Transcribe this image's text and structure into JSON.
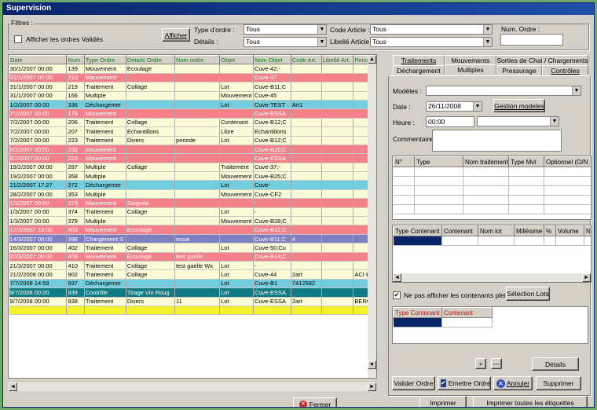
{
  "window": {
    "title": "Supervision"
  },
  "filters": {
    "group_label": "Filtres :",
    "show_validated_label": "Afficher les ordres Validés",
    "afficher_button": "Afficher",
    "type_ordre_label": "Type d'ordre :",
    "type_ordre_value": "Tous",
    "details_label": "Détails :",
    "details_value": "Tous",
    "code_article_label": "Code Article :",
    "code_article_value": "Tous",
    "libelle_article_label": "Libellé Article :",
    "libelle_article_value": "Tous",
    "num_ordre_label": "Num. Ordre :",
    "num_ordre_value": ""
  },
  "grid": {
    "columns": [
      "Date",
      "Num.",
      "Type Ordre",
      "Détails Ordre",
      "Nom ordre",
      "Objet",
      "Nom Objet",
      "Code Art.",
      "Libellé Art.",
      "Personn"
    ],
    "rows": [
      {
        "color": "lightyellow",
        "cells": [
          "30/1/2007 00:00",
          "139",
          "Mouvement",
          "Ecoulage",
          "",
          "",
          "Cuve-42;-",
          "",
          "",
          ""
        ]
      },
      {
        "color": "pink",
        "cells": [
          "31/1/2007 00:00",
          "210",
          "Mouvement",
          "",
          "",
          "",
          "Cuve-37",
          "",
          "",
          ""
        ]
      },
      {
        "color": "lightyellow",
        "cells": [
          "31/1/2007 00:00",
          "219",
          "Traitement",
          "Collage",
          "",
          "Lot",
          "Cuve-B11;C",
          "",
          "",
          ""
        ]
      },
      {
        "color": "lightyellow",
        "cells": [
          "31/1/2007 00:00",
          "166",
          "Multiple",
          "",
          "",
          "Mouvement",
          "Cuve-45",
          "",
          "",
          ""
        ]
      },
      {
        "color": "cyan",
        "cells": [
          "1/2/2007 00:00",
          "336",
          "Déchargemer",
          "",
          "",
          "Lot",
          "Cuve-TEST",
          "Art1",
          "",
          ""
        ]
      },
      {
        "color": "pink",
        "cells": [
          "7/2/2007 00:00",
          "179",
          "Mouvement",
          "",
          "",
          "",
          "Cuve-ESSA",
          "",
          "",
          ""
        ]
      },
      {
        "color": "lightyellow",
        "cells": [
          "7/2/2007 00:00",
          "206",
          "Traitement",
          "Collage",
          "",
          "Contenant",
          "Cuve-B12;C",
          "",
          "",
          ""
        ]
      },
      {
        "color": "lightyellow",
        "cells": [
          "7/2/2007 00:00",
          "207",
          "Traitement",
          "Echantillons",
          "",
          "Libre",
          "Echantillons",
          "",
          "",
          ""
        ]
      },
      {
        "color": "lightyellow",
        "cells": [
          "7/2/2007 00:00",
          "223",
          "Traitement",
          "Divers",
          "periode",
          "Lot",
          "Cuve-B12;C",
          "",
          "",
          ""
        ]
      },
      {
        "color": "pink",
        "cells": [
          "8/2/2007 00:00",
          "235",
          "Mouvement",
          "",
          "",
          "",
          "Cuve-B25;C",
          "",
          "",
          ""
        ]
      },
      {
        "color": "pink",
        "cells": [
          "8/2/2007 00:00",
          "226",
          "Mouvement",
          "",
          "",
          "",
          "Cuve-ESSA",
          "",
          "",
          ""
        ]
      },
      {
        "color": "lightyellow",
        "cells": [
          "19/2/2007 00:00",
          "287",
          "Multiple",
          "Collage",
          "",
          "Traitement",
          "Cuve-37;-",
          "",
          "",
          ""
        ]
      },
      {
        "color": "lightyellow",
        "cells": [
          "19/2/2007 00:00",
          "358",
          "Multiple",
          "",
          "",
          "Mouvement",
          "Cuve-B25;C",
          "",
          "",
          ""
        ]
      },
      {
        "color": "cyan",
        "cells": [
          "21/2/2007 17:27",
          "372",
          "Déchargemer",
          "",
          "",
          "Lot",
          "Cuve-",
          "",
          "",
          ""
        ]
      },
      {
        "color": "lightyellow",
        "cells": [
          "28/2/2007 00:00",
          "353",
          "Multiple",
          "",
          "",
          "Mouvement",
          "Cuve-CF2",
          "",
          "",
          ""
        ]
      },
      {
        "color": "pink",
        "cells": [
          "1/3/2007 00:00",
          "373",
          "Mouvement",
          "Saignée",
          "",
          "",
          "-",
          "",
          "",
          ""
        ]
      },
      {
        "color": "lightyellow",
        "cells": [
          "1/3/2007 00:00",
          "374",
          "Traitement",
          "Collage",
          "",
          "Lot",
          "-",
          "",
          "",
          ""
        ]
      },
      {
        "color": "lightyellow",
        "cells": [
          "1/3/2007 00:00",
          "378",
          "Multiple",
          "",
          "",
          "Mouvement",
          "Cuve-B28;C",
          "",
          "",
          ""
        ]
      },
      {
        "color": "pink",
        "cells": [
          "12/3/2007 18:00",
          "403",
          "Mouvement",
          "Ecoulage",
          "",
          "",
          "Cuve-B12;C",
          "",
          "",
          ""
        ]
      },
      {
        "color": "purple",
        "cells": [
          "14/3/2007 00:00",
          "398",
          "Chargement S",
          "",
          "essai",
          "",
          "Cuve-B11;C",
          "4",
          "",
          ""
        ]
      },
      {
        "color": "lightyellow",
        "cells": [
          "16/3/2007 00:00",
          "402",
          "Traitement",
          "Collage",
          "",
          "Lot",
          "Cuve-50;Cu",
          "",
          "",
          ""
        ]
      },
      {
        "color": "pink",
        "cells": [
          "20/3/2007 00:00",
          "409",
          "Mouvement",
          "Ecoulage",
          "test gaelle",
          "",
          "Cuve-B14;C",
          "",
          "",
          ""
        ]
      },
      {
        "color": "lightyellow",
        "cells": [
          "21/3/2007 00:00",
          "410",
          "Traitement",
          "Collage",
          "test gaelle Wx",
          "Lot",
          "-",
          "",
          "",
          ""
        ]
      },
      {
        "color": "lightyellow",
        "cells": [
          "21/2/2008 00:00",
          "902",
          "Traitement",
          "Collage",
          "",
          "Lot",
          "Cuve-44",
          "2art",
          "",
          "ACI Berr"
        ]
      },
      {
        "color": "cyan",
        "cells": [
          "7/7/2008 14:59",
          "937",
          "Déchargemer",
          "",
          "",
          "Lot",
          "Cuve-B1",
          "7412582",
          "",
          ""
        ]
      },
      {
        "color": "teal",
        "cells": [
          "9/7/2008 00:00",
          "939",
          "Contrôle",
          "Tirage Vin Roug",
          "",
          "Lot",
          "Cuve-ESSA",
          "",
          "",
          ""
        ]
      },
      {
        "color": "lightyellow",
        "cells": [
          "9/7/2008 00:00",
          "938",
          "Traitement",
          "Divers",
          "11",
          "Lot",
          "Cuve-ESSA",
          "2art",
          "",
          "BERGEY"
        ]
      },
      {
        "color": "yellow",
        "cells": [
          "",
          "",
          "",
          "",
          "",
          "",
          "",
          "",
          "",
          ""
        ]
      }
    ]
  },
  "tabs": {
    "row1": [
      "Traitements",
      "Mouvements",
      "Sorties de Chai / Chargements"
    ],
    "row2": [
      "Déchargement",
      "Multiples",
      "Pressurage",
      "Contrôles"
    ],
    "active": "Multiples"
  },
  "multiples": {
    "modeles_label": "Modèles :",
    "modeles_value": "",
    "date_label": "Date :",
    "date_value": "26/11/2008",
    "gestion_button": "Gestion modeles",
    "heure_label": "Heure :",
    "heure_value": "00:00",
    "commentaire_label": "Commentaire :",
    "commentaire_value": "",
    "ops_columns": [
      "N°",
      "Type",
      "Nom traitement",
      "Type Mvt",
      "Optionnel (O/N"
    ],
    "cont_columns": [
      "Type Contenant",
      "Contenant",
      "Nom lot",
      "Millésime",
      "%",
      "Volume",
      "N"
    ],
    "hide_full_label": "Ne pas afficher les contenants pleins",
    "selection_lots_button": "Sélection Lots",
    "sel_columns": [
      "Type Contenant",
      "Contenant"
    ],
    "plus_button": "+",
    "minus_button": "—",
    "details_button": "Détails",
    "valider_button": "Valider Ordre",
    "emettre_label": "Emettre Ordre",
    "annuler_button": "Annuler",
    "supprimer_button": "Supprimer"
  },
  "footer": {
    "fermer_button": "Fermer",
    "imprimer_button": "Imprimer",
    "imprimer_etiquettes_button": "Imprimer toutes les étiquettes"
  },
  "colors": {
    "pink": "#f4808a",
    "cyan": "#72cedf",
    "lightyellow": "#fbfbd8",
    "purple": "#7d7fc2",
    "teal": "#127c86",
    "yellow": "#f2f22a",
    "title": "#0a246a"
  }
}
